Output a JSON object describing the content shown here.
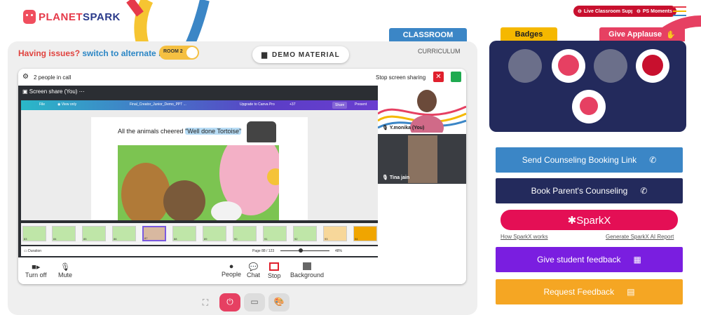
{
  "header": {
    "logo_a": "PLANET",
    "logo_b": "SPARK",
    "live_support": "Live Classroom Support",
    "ps_moments": "PS Moments"
  },
  "stage": {
    "issue_text": "Having issues?",
    "switch_link": "switch to alternate room",
    "room_toggle": "ROOM 2",
    "demo_material": "DEMO MATERIAL",
    "tab_classroom": "CLASSROOM",
    "tab_curriculum": "CURRICULUM"
  },
  "call": {
    "people_count": "2 people in call",
    "stop_sharing": "Stop screen sharing",
    "share_title": "Screen share (You)",
    "canva": {
      "file": "File",
      "view_only": "View only",
      "doc_name": "Final_Creator_Junior_Demo_PPT ...",
      "upgrade": "Upgrade to Canva Pro",
      "avatars_more": "+37",
      "share": "Share",
      "present": "Present"
    },
    "slide_caption_a": "All the animals cheered ",
    "slide_caption_b": "\"Well done Tortoise\"",
    "thumb_numbers": [
      "83",
      "84",
      "85",
      "86",
      "87",
      "88",
      "89",
      "90",
      "91",
      "92",
      "93",
      "94",
      "95"
    ],
    "duration": "Duration",
    "page": "Page 88 / 123",
    "zoom": "48%",
    "tiles": [
      {
        "name": "Y.monika (You)"
      },
      {
        "name": "Tina jain"
      }
    ],
    "controls": {
      "turn_off": "Turn off",
      "mute": "Mute",
      "people": "People",
      "chat": "Chat",
      "stop": "Stop",
      "background": "Background"
    }
  },
  "right": {
    "tab_badges": "Badges",
    "tab_applause": "Give Applause",
    "buttons": {
      "counseling_link": "Send Counseling Booking Link",
      "parent_counseling": "Book Parent's Counseling",
      "sparkx": "SparkX",
      "feedback": "Give student feedback",
      "request": "Request Feedback"
    },
    "links": {
      "how": "How SparkX works",
      "generate": "Generate SparkX AI Report"
    }
  },
  "colors": {
    "blue": "#3b86c6",
    "navy": "#232a5c",
    "red": "#e63a4a",
    "purple": "#7a1ee0",
    "orange": "#f5a623",
    "green": "#2ecc71"
  }
}
